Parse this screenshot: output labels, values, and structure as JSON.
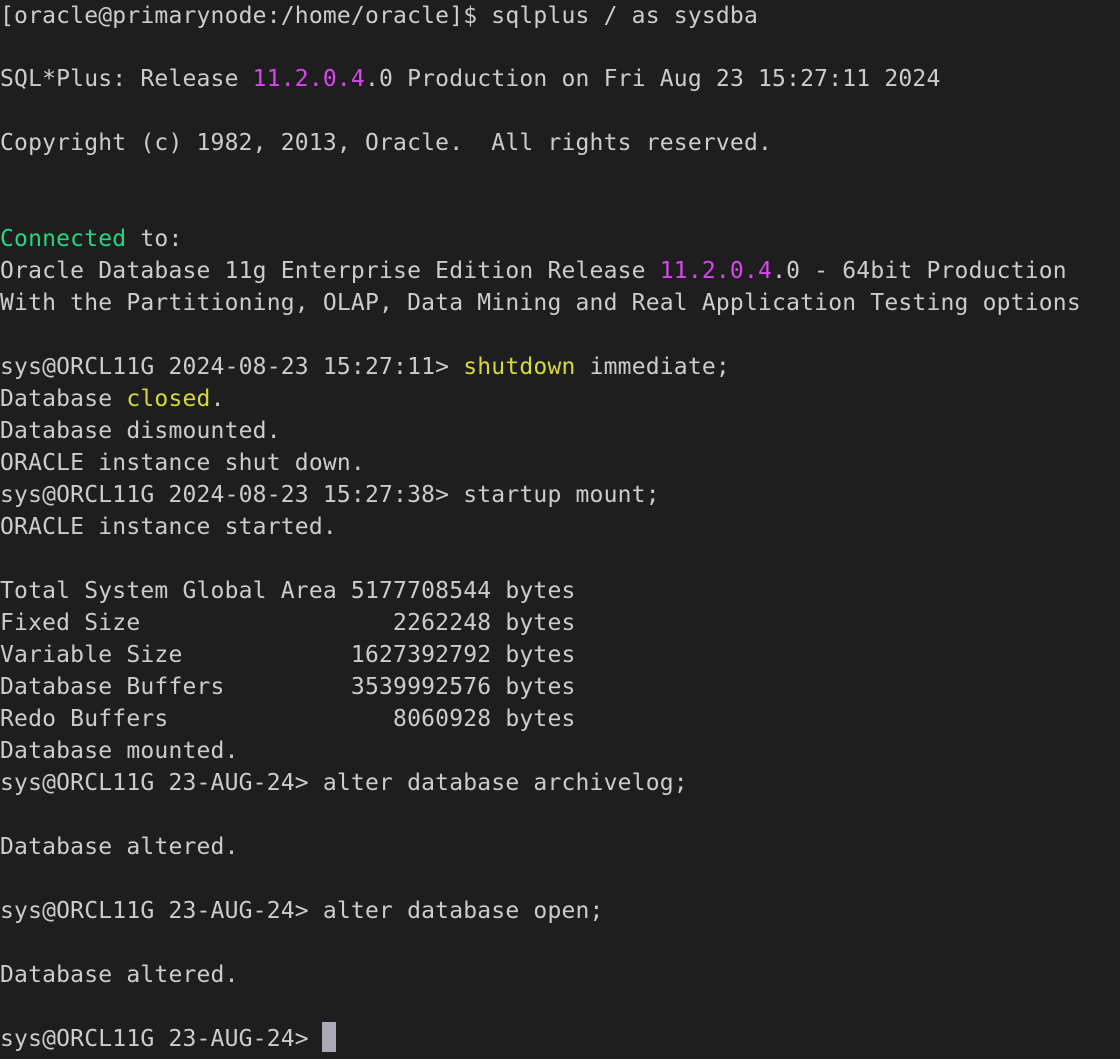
{
  "terminal": {
    "colors": {
      "background": "#1e1e1e",
      "foreground": "#cccccc",
      "version_highlight": "#d946ef",
      "connected_highlight": "#22d686",
      "keyword_highlight": "#d8d83a",
      "cursor": "#aaa9b8"
    },
    "lines": {
      "l01": "[oracle@primarynode:/home/oracle]$ sqlplus / as sysdba",
      "l03a": "SQL*Plus: Release ",
      "l03b": "11.2.0.4",
      "l03c": ".0 Production on Fri Aug 23 15:27:11 2024",
      "l05": "Copyright (c) 1982, 2013, Oracle.  All rights reserved.",
      "l08a": "Connected",
      "l08b": " to:",
      "l09a": "Oracle Database 11g Enterprise Edition Release ",
      "l09b": "11.2.0.4",
      "l09c": ".0 - 64bit Production",
      "l10": "With the Partitioning, OLAP, Data Mining and Real Application Testing options",
      "l12a": "sys@ORCL11G 2024-08-23 15:27:11> ",
      "l12b": "shutdown",
      "l12c": " immediate;",
      "l13a": "Database ",
      "l13b": "closed",
      "l13c": ".",
      "l14": "Database dismounted.",
      "l15": "ORACLE instance shut down.",
      "l16": "sys@ORCL11G 2024-08-23 15:27:38> startup mount;",
      "l17": "ORACLE instance started.",
      "l19": "Total System Global Area 5177708544 bytes",
      "l20": "Fixed Size                  2262248 bytes",
      "l21": "Variable Size            1627392792 bytes",
      "l22": "Database Buffers         3539992576 bytes",
      "l23": "Redo Buffers                8060928 bytes",
      "l24": "Database mounted.",
      "l25": "sys@ORCL11G 23-AUG-24> alter database archivelog;",
      "l27": "Database altered.",
      "l29": "sys@ORCL11G 23-AUG-24> alter database open;",
      "l31": "Database altered.",
      "l33": "sys@ORCL11G 23-AUG-24> "
    }
  }
}
